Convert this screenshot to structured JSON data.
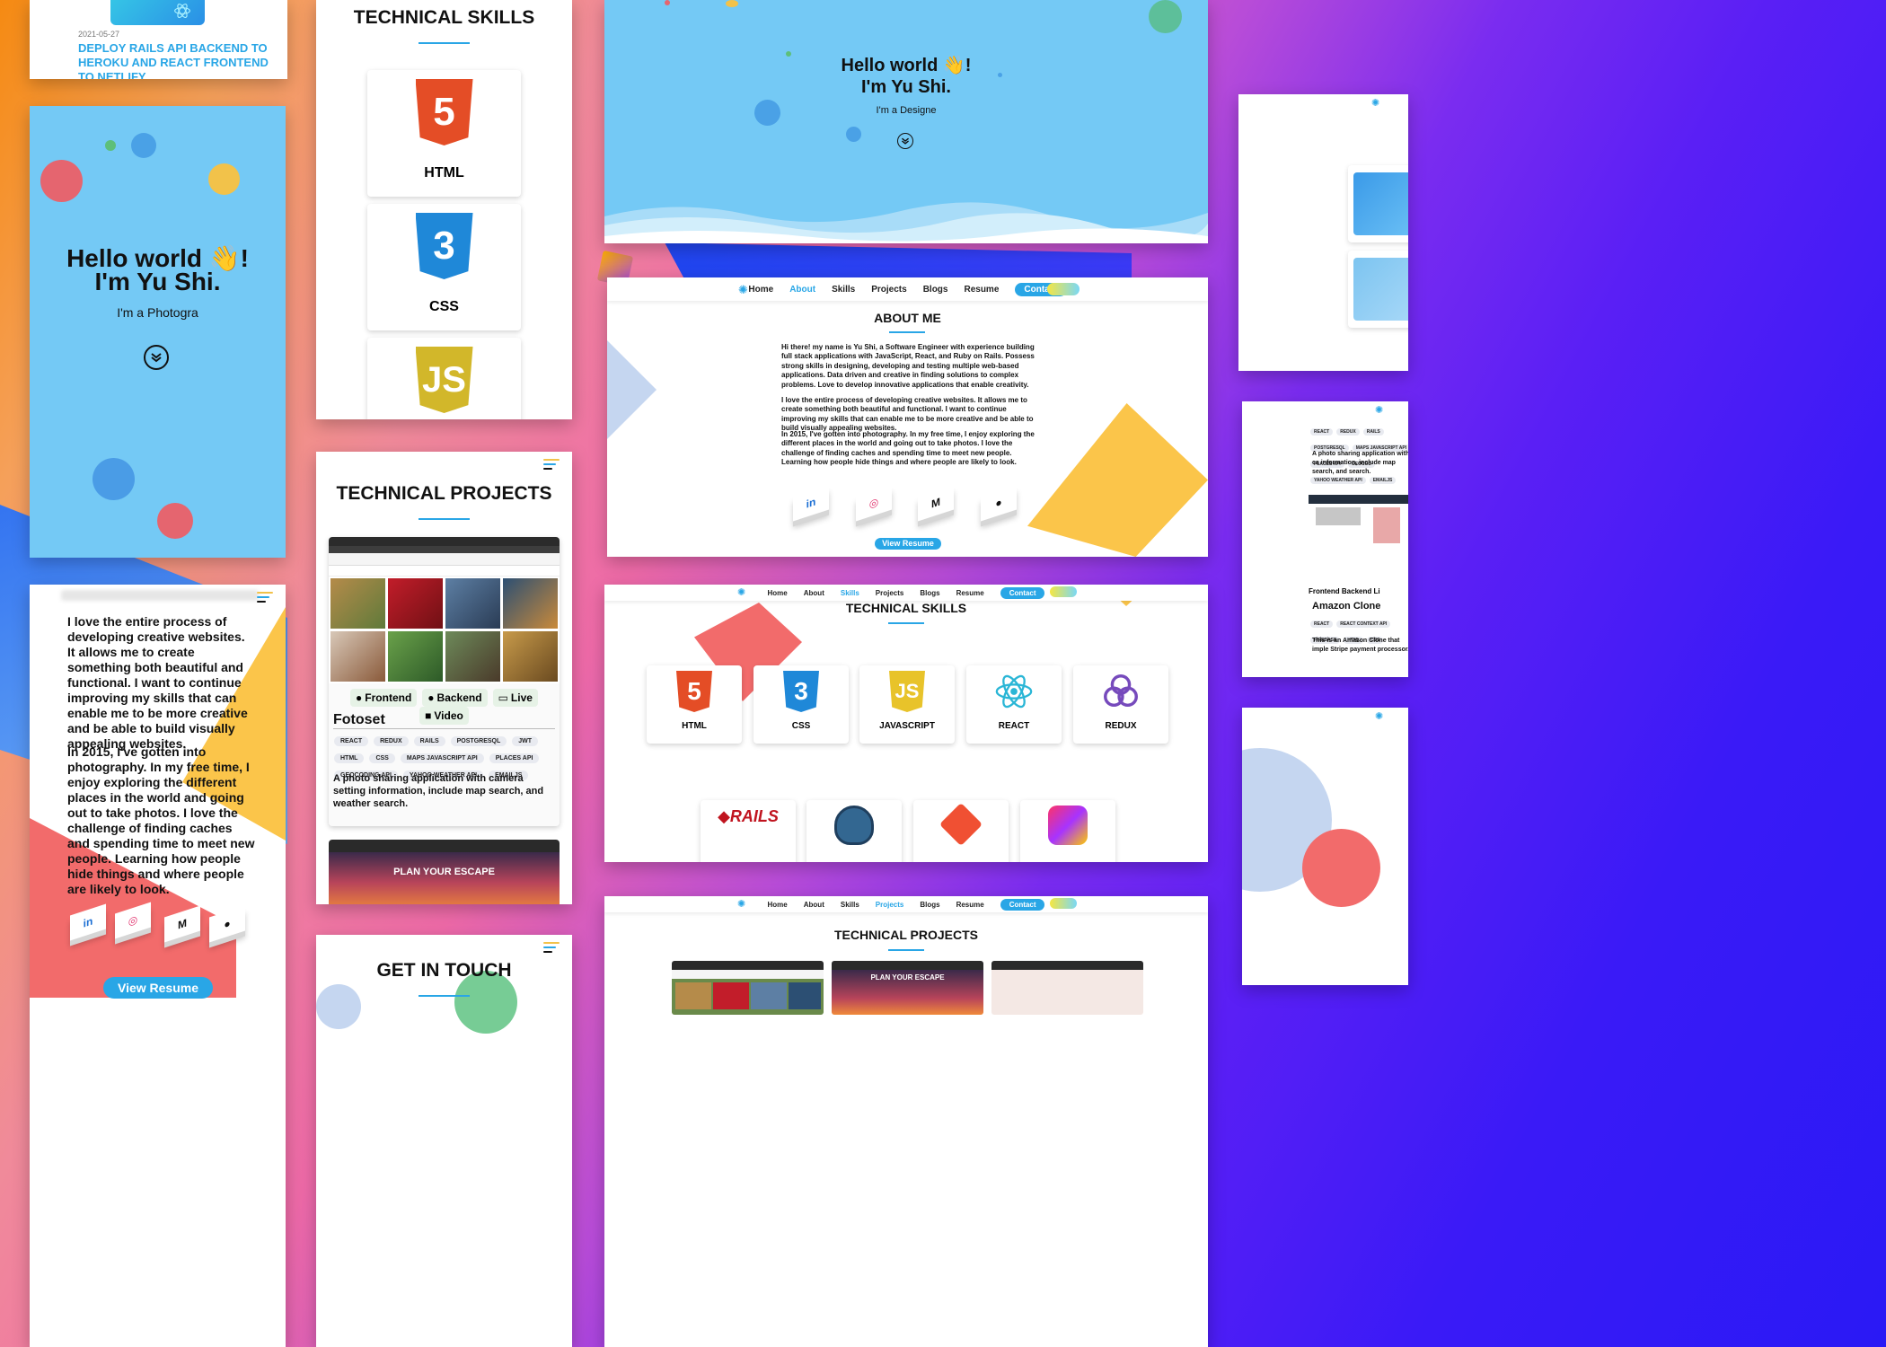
{
  "hero": {
    "greeting": "Hello world 👋!",
    "name": "I'm Yu Shi.",
    "tagline_mobile": "I'm a Photogra",
    "tagline_desktop": "I'm a Designe"
  },
  "nav": {
    "items": [
      "Home",
      "About",
      "Skills",
      "Projects",
      "Blogs",
      "Resume",
      "Contact"
    ]
  },
  "blog": {
    "date": "2021-05-27",
    "title": "DEPLOY RAILS API BACKEND TO HEROKU AND REACT FRONTEND TO NETLIFY"
  },
  "about": {
    "heading": "ABOUT ME",
    "p1": "Hi there! my name is Yu Shi, a Software Engineer with experience building full stack applications with JavaScript, React, and Ruby on Rails. Possess strong skills in designing, developing and testing multiple web-based applications. Data driven and creative in finding solutions to complex problems. Love to develop innovative applications that enable creativity.",
    "p2": "I love the entire process of developing creative websites. It allows me to create something both beautiful and functional. I want to continue improving my skills that can enable me to be more creative and be able to build visually appealing websites.",
    "p3": "In 2015, I've gotten into photography. In my free time, I enjoy exploring the different places in the world and going out to take photos. I love the challenge of finding caches and spending time to meet new people. Learning how people hide things and where people are likely to look.",
    "view_resume": "View Resume"
  },
  "skills": {
    "heading": "TECHNICAL SKILLS",
    "items": [
      "HTML",
      "CSS",
      "JAVASCRIPT",
      "REACT",
      "REDUX"
    ],
    "mobile_items": [
      "HTML",
      "CSS"
    ]
  },
  "projects": {
    "heading": "TECHNICAL PROJECTS",
    "fotoset": {
      "title": "Fotoset",
      "tags": [
        "REACT",
        "REDUX",
        "RAILS",
        "POSTGRESQL",
        "JWT",
        "HTML",
        "CSS",
        "MAPS JAVASCRIPT API",
        "PLACES API",
        "GEOCODING API",
        "YAHOO WEATHER API",
        "EMAILJS"
      ],
      "description": "A photo sharing application with camera setting information, include map search, and weather search.",
      "buttons": [
        "Frontend",
        "Backend",
        "Live",
        "Video"
      ]
    },
    "escape": {
      "headline": "PLAN YOUR ESCAPE"
    },
    "amazon": {
      "title": "Amazon Clone",
      "tags": [
        "REACT",
        "REACT CONTEXT API",
        "FIREBASE",
        "HTML",
        "CSS"
      ],
      "description": "This is an Amazon Clone that imple Stripe payment processor.",
      "buttons": [
        "Frontend",
        "Backend",
        "Li"
      ]
    },
    "right_fotoset": {
      "tags": [
        "REACT",
        "REDUX",
        "RAILS",
        "POSTGRESQL",
        "MAPS JAVASCRIPT API",
        "PLACES API",
        "GEOCOD",
        "YAHOO WEATHER API",
        "EMAILJS"
      ],
      "description": "A photo sharing application with ca information, include map search, and search."
    }
  },
  "contact": {
    "heading": "GET IN TOUCH"
  },
  "mobile_about": {
    "p2": "I love the entire process of developing creative websites. It allows me to create something both beautiful and functional. I want to continue improving my skills that can enable me to be more creative and be able to build visually appealing websites.",
    "p3": "In 2015, I've gotten into photography. In my free time, I enjoy exploring the different places in the world and going out to take photos. I love the challenge of finding caches and spending time to meet new people. Learning how people hide things and where people are likely to look.",
    "view_resume": "View Resume"
  },
  "icons": [
    "linkedin-icon",
    "instagram-icon",
    "medium-icon",
    "github-icon",
    "chevron-double-down-icon",
    "hamburger-icon",
    "logo-icon"
  ],
  "colors": {
    "accent": "#29a6e6",
    "hero_blue": "#74c9f5",
    "html_orange": "#e44d26",
    "css_blue": "#1f88d8",
    "js_yellow": "#e8c32a",
    "coral": "#f26b6b",
    "sunflower": "#fbc54a"
  }
}
